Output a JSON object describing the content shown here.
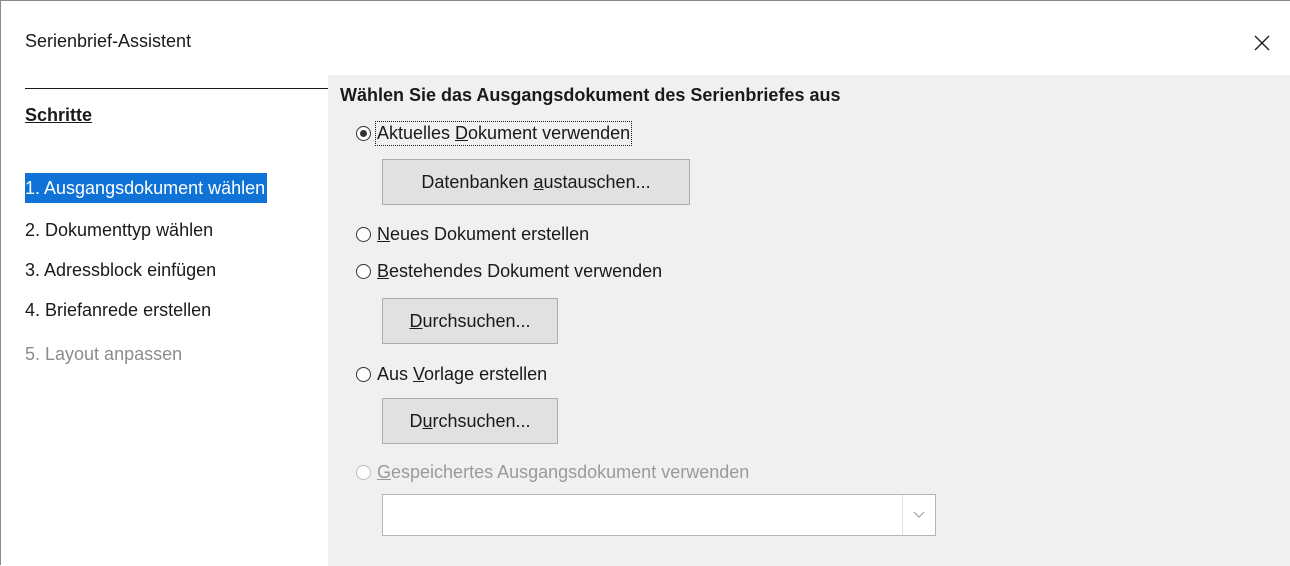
{
  "window": {
    "title": "Serienbrief-Assistent"
  },
  "icons": {
    "close": "close-icon",
    "combo_arrow": "chevron-down-icon"
  },
  "steps": {
    "heading": "Schritte",
    "items": [
      {
        "label": "1. Ausgangsdokument wählen",
        "state": "active"
      },
      {
        "label": "2. Dokumenttyp wählen",
        "state": "normal"
      },
      {
        "label": "3. Adressblock einfügen",
        "state": "normal"
      },
      {
        "label": "4. Briefanrede erstellen",
        "state": "normal"
      },
      {
        "label": "5. Layout anpassen",
        "state": "disabled"
      }
    ]
  },
  "content": {
    "heading": "Wählen Sie das Ausgangsdokument des Serienbriefes aus",
    "options": {
      "current": {
        "pre": "Aktuelles ",
        "mnemonic": "D",
        "post": "okument verwenden",
        "checked": true
      },
      "new": {
        "pre": "",
        "mnemonic": "N",
        "post": "eues Dokument erstellen",
        "checked": false
      },
      "existing": {
        "pre": "",
        "mnemonic": "B",
        "post": "estehendes Dokument verwenden",
        "checked": false
      },
      "template": {
        "pre": "Aus ",
        "mnemonic": "V",
        "post": "orlage erstellen",
        "checked": false
      },
      "saved": {
        "pre": "",
        "mnemonic": "G",
        "post": "espeichertes Ausgangsdokument verwenden",
        "checked": false,
        "disabled": true
      }
    },
    "buttons": {
      "exchange_db": {
        "pre": "Datenbanken ",
        "mnemonic": "a",
        "post": "ustauschen..."
      },
      "browse_existing": {
        "pre": "",
        "mnemonic": "D",
        "post": "urchsuchen..."
      },
      "browse_template": {
        "pre": "D",
        "mnemonic": "u",
        "post": "rchsuchen..."
      }
    },
    "saved_docs_combo": {
      "value": ""
    }
  },
  "colors": {
    "selection": "#0f72d6",
    "panel_bg": "#f0f0f0",
    "disabled_text": "#8c8c8c"
  }
}
